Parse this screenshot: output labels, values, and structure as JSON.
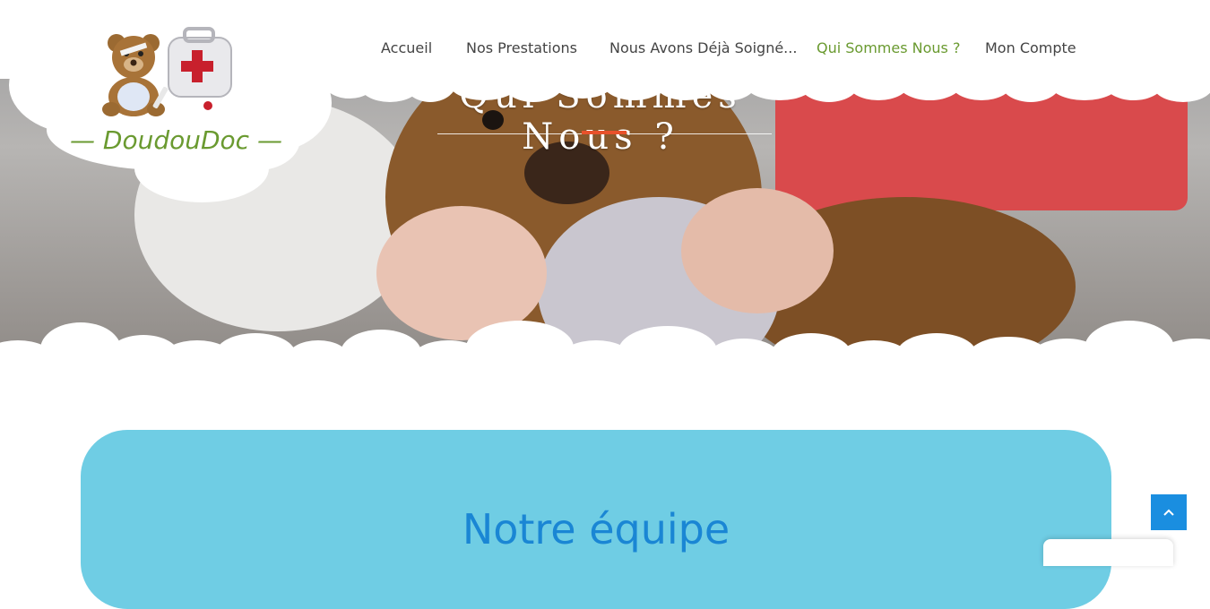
{
  "brand": {
    "name": "DoudouDoc",
    "dash_left": "—",
    "dash_right": "—"
  },
  "nav": {
    "items": [
      {
        "label": "Accueil",
        "active": false
      },
      {
        "label": "Nos Prestations",
        "active": false
      },
      {
        "label": "Nous Avons Déjà Soigné...",
        "active": false
      },
      {
        "label": "Qui Sommes Nous ?",
        "active": true
      },
      {
        "label": "Mon Compte",
        "active": false
      }
    ]
  },
  "hero": {
    "title": "Qui Sommes Nous ?"
  },
  "section": {
    "title": "Notre équipe"
  },
  "colors": {
    "green": "#6a9a30",
    "accent": "#e8512b",
    "card": "#6fcde4",
    "title_blue": "#1a86d4",
    "top_button": "#1a8ee0"
  },
  "icons": {
    "back_to_top": "chevron-up-icon",
    "logo": "teddy-bear-medical-kit-icon"
  }
}
